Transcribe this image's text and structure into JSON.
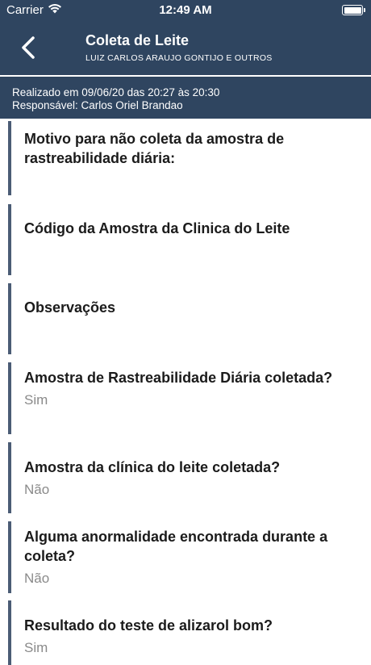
{
  "status_bar": {
    "carrier": "Carrier",
    "time": "12:49 AM"
  },
  "nav": {
    "title": "Coleta de Leite",
    "subtitle": "LUIZ CARLOS ARAUJO GONTIJO E OUTROS"
  },
  "meta": {
    "realizado": "Realizado em 09/06/20 das 20:27 às 20:30",
    "responsavel": "Responsável: Carlos Oriel Brandao"
  },
  "items": [
    {
      "label": "Motivo para não coleta da amostra de rastreabilidade diária:",
      "value": ""
    },
    {
      "label": "Código da Amostra da Clinica do Leite",
      "value": ""
    },
    {
      "label": "Observações",
      "value": ""
    },
    {
      "label": "Amostra de Rastreabilidade Diária coletada?",
      "value": "Sim"
    },
    {
      "label": "Amostra da clínica do leite coletada?",
      "value": "Não"
    },
    {
      "label": "Alguma anormalidade encontrada durante a coleta?",
      "value": "Não"
    },
    {
      "label": "Resultado do teste de alizarol bom?",
      "value": "Sim"
    }
  ],
  "colors": {
    "header_bg": "#2f4560",
    "item_bar": "#4b5c75",
    "value_text": "#8a8a8a"
  },
  "icons": {
    "wifi": "wifi-icon",
    "battery": "battery-icon",
    "back": "chevron-left-icon"
  }
}
